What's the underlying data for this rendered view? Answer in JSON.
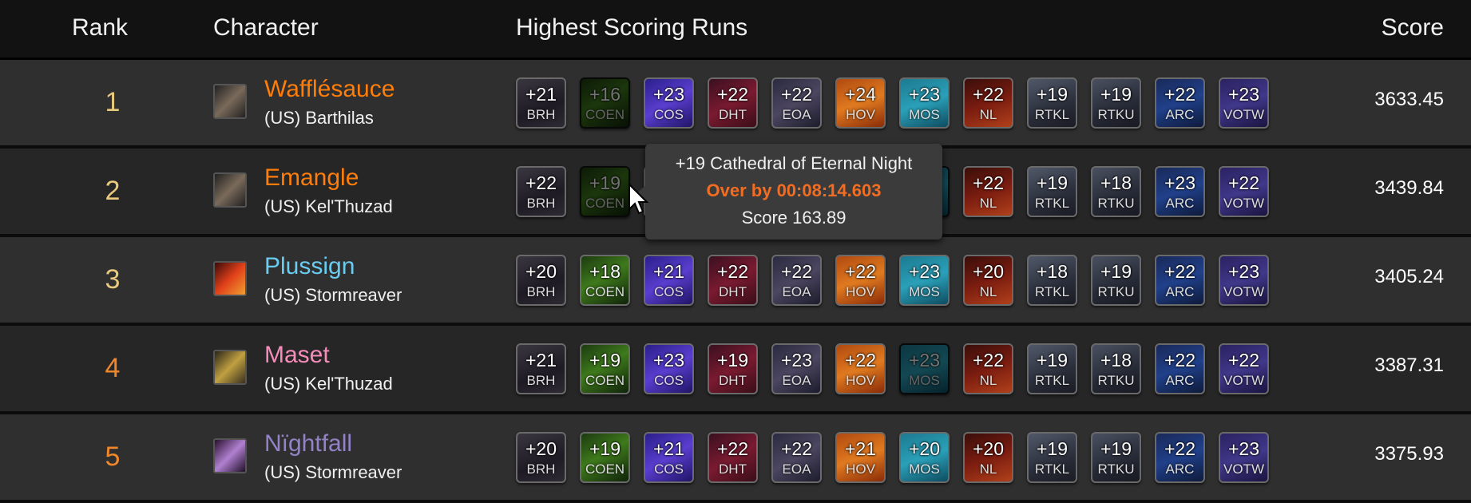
{
  "header": {
    "rank": "Rank",
    "character": "Character",
    "runs": "Highest Scoring Runs",
    "score": "Score"
  },
  "colors": {
    "rank_top": "#e8c97d",
    "rank_other": "#f0872a",
    "druid": "#ff7d0a",
    "mage": "#69ccf0",
    "paladin": "#f58cba",
    "warlock": "#9482c9",
    "depleted_text": "#f26d21"
  },
  "dungeons": [
    "BRH",
    "COEN",
    "COS",
    "DHT",
    "EOA",
    "HOV",
    "MOS",
    "NL",
    "RTKL",
    "RTKU",
    "ARC",
    "VOTW"
  ],
  "rows": [
    {
      "rank": "1",
      "name": "Wafflésauce",
      "realm": "(US) Barthilas",
      "class": "druid",
      "icon": "bear-claw-icon",
      "score": "3633.45",
      "runs": [
        {
          "lvl": "+21"
        },
        {
          "lvl": "+16",
          "depleted": true
        },
        {
          "lvl": "+23"
        },
        {
          "lvl": "+22"
        },
        {
          "lvl": "+22"
        },
        {
          "lvl": "+24"
        },
        {
          "lvl": "+23"
        },
        {
          "lvl": "+22"
        },
        {
          "lvl": "+19"
        },
        {
          "lvl": "+19"
        },
        {
          "lvl": "+22"
        },
        {
          "lvl": "+23"
        }
      ]
    },
    {
      "rank": "2",
      "name": "Emangle",
      "realm": "(US) Kel'Thuzad",
      "class": "druid",
      "icon": "bear-claw-icon",
      "score": "3439.84",
      "runs": [
        {
          "lvl": "+22"
        },
        {
          "lvl": "+19",
          "depleted": true
        },
        {
          "lvl": ""
        },
        {
          "lvl": ""
        },
        {
          "lvl": ""
        },
        {
          "lvl": ""
        },
        {
          "lvl": "",
          "depleted": true
        },
        {
          "lvl": "+22"
        },
        {
          "lvl": "+19"
        },
        {
          "lvl": "+18"
        },
        {
          "lvl": "+23"
        },
        {
          "lvl": "+22"
        }
      ]
    },
    {
      "rank": "3",
      "name": "Plussign",
      "realm": "(US) Stormreaver",
      "class": "mage",
      "icon": "fire-spear-icon",
      "score": "3405.24",
      "runs": [
        {
          "lvl": "+20"
        },
        {
          "lvl": "+18"
        },
        {
          "lvl": "+21"
        },
        {
          "lvl": "+22"
        },
        {
          "lvl": "+22"
        },
        {
          "lvl": "+22"
        },
        {
          "lvl": "+23"
        },
        {
          "lvl": "+20"
        },
        {
          "lvl": "+18"
        },
        {
          "lvl": "+19"
        },
        {
          "lvl": "+22"
        },
        {
          "lvl": "+23"
        }
      ]
    },
    {
      "rank": "4",
      "name": "Maset",
      "realm": "(US) Kel'Thuzad",
      "class": "paladin",
      "icon": "holy-hammer-icon",
      "score": "3387.31",
      "runs": [
        {
          "lvl": "+21"
        },
        {
          "lvl": "+19"
        },
        {
          "lvl": "+23"
        },
        {
          "lvl": "+19"
        },
        {
          "lvl": "+23"
        },
        {
          "lvl": "+22"
        },
        {
          "lvl": "+23",
          "depleted": true
        },
        {
          "lvl": "+22"
        },
        {
          "lvl": "+19"
        },
        {
          "lvl": "+18"
        },
        {
          "lvl": "+22"
        },
        {
          "lvl": "+22"
        }
      ]
    },
    {
      "rank": "5",
      "name": "Nïghtfall",
      "realm": "(US) Stormreaver",
      "class": "warlock",
      "icon": "shadow-bolt-icon",
      "score": "3375.93",
      "runs": [
        {
          "lvl": "+20"
        },
        {
          "lvl": "+19"
        },
        {
          "lvl": "+21"
        },
        {
          "lvl": "+22"
        },
        {
          "lvl": "+22"
        },
        {
          "lvl": "+21"
        },
        {
          "lvl": "+20"
        },
        {
          "lvl": "+20"
        },
        {
          "lvl": "+19"
        },
        {
          "lvl": "+19"
        },
        {
          "lvl": "+22"
        },
        {
          "lvl": "+23"
        }
      ]
    }
  ],
  "tooltip": {
    "title": "+19 Cathedral of Eternal Night",
    "status": "Over by 00:08:14.603",
    "score": "Score 163.89"
  }
}
